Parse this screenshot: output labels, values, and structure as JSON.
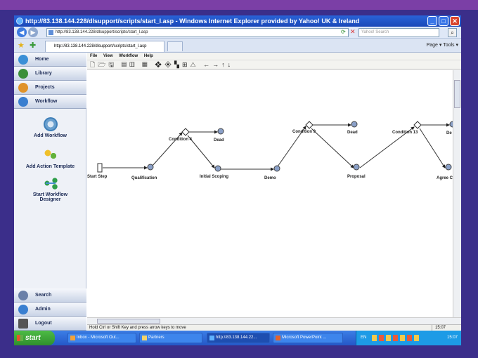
{
  "window": {
    "title": "http://83.138.144.228/dlsupport/scripts/start_l.asp - Windows Internet Explorer provided by Yahoo! UK & Ireland",
    "url": "http://83.138.144.228/dlsupport/scripts/start_l.asp",
    "tab_label": "http://83.138.144.228/dlsupport/scripts/start_l.asp",
    "search_placeholder": "Yahoo! Search",
    "tools_text": "Page ▾   Tools ▾"
  },
  "sidebar": {
    "top_items": [
      {
        "label": "Home",
        "icon": "home-icon",
        "color": "#3a8fd6"
      },
      {
        "label": "Library",
        "icon": "library-icon",
        "color": "#3b8f3a"
      },
      {
        "label": "Projects",
        "icon": "projects-icon",
        "color": "#e0932a"
      },
      {
        "label": "Workflow",
        "icon": "workflow-icon",
        "color": "#3a7fd0"
      }
    ],
    "panel_items": [
      {
        "label": "Add Workflow",
        "icon": "gear-icon"
      },
      {
        "label": "Add Action Template",
        "icon": "people-icon"
      },
      {
        "label": "Start Workflow Designer",
        "icon": "workflow-designer-icon"
      }
    ],
    "bottom_items": [
      {
        "label": "Search",
        "icon": "search-icon",
        "color": "#6a7fa8"
      },
      {
        "label": "Admin",
        "icon": "admin-icon",
        "color": "#3a7fd0"
      },
      {
        "label": "Logout",
        "icon": "logout-icon",
        "color": "#555"
      }
    ]
  },
  "menu": {
    "items": [
      "File",
      "View",
      "Workflow",
      "Help"
    ]
  },
  "toolbar": {
    "icons": "🗋🗁🖫 ▤▥ ▦ ❖◈▚⊞△ ←→↑↓"
  },
  "diagram": {
    "nodes": [
      {
        "label": "Start Step",
        "type": "start"
      },
      {
        "label": "Qualification",
        "type": "step"
      },
      {
        "label": "Condition 4",
        "type": "condition"
      },
      {
        "label": "Dead",
        "type": "step"
      },
      {
        "label": "Initial Scoping",
        "type": "step"
      },
      {
        "label": "Demo",
        "type": "step"
      },
      {
        "label": "Condition 9",
        "type": "condition"
      },
      {
        "label": "Dead",
        "type": "step"
      },
      {
        "label": "Proposal",
        "type": "step"
      },
      {
        "label": "Condition 13",
        "type": "condition"
      },
      {
        "label": "De",
        "type": "step"
      },
      {
        "label": "Agree Co",
        "type": "step"
      }
    ]
  },
  "status": {
    "message": "Hold Ctrl or Shift Key and press arrow keys to move",
    "time": "15:07"
  },
  "taskbar": {
    "start_label": "start",
    "tasks": [
      "Inbox - Microsoft Out...",
      "Partners",
      "http://83.138.144.22...",
      "Microsoft PowerPoint ..."
    ],
    "language": "EN",
    "clock": "15:07"
  }
}
